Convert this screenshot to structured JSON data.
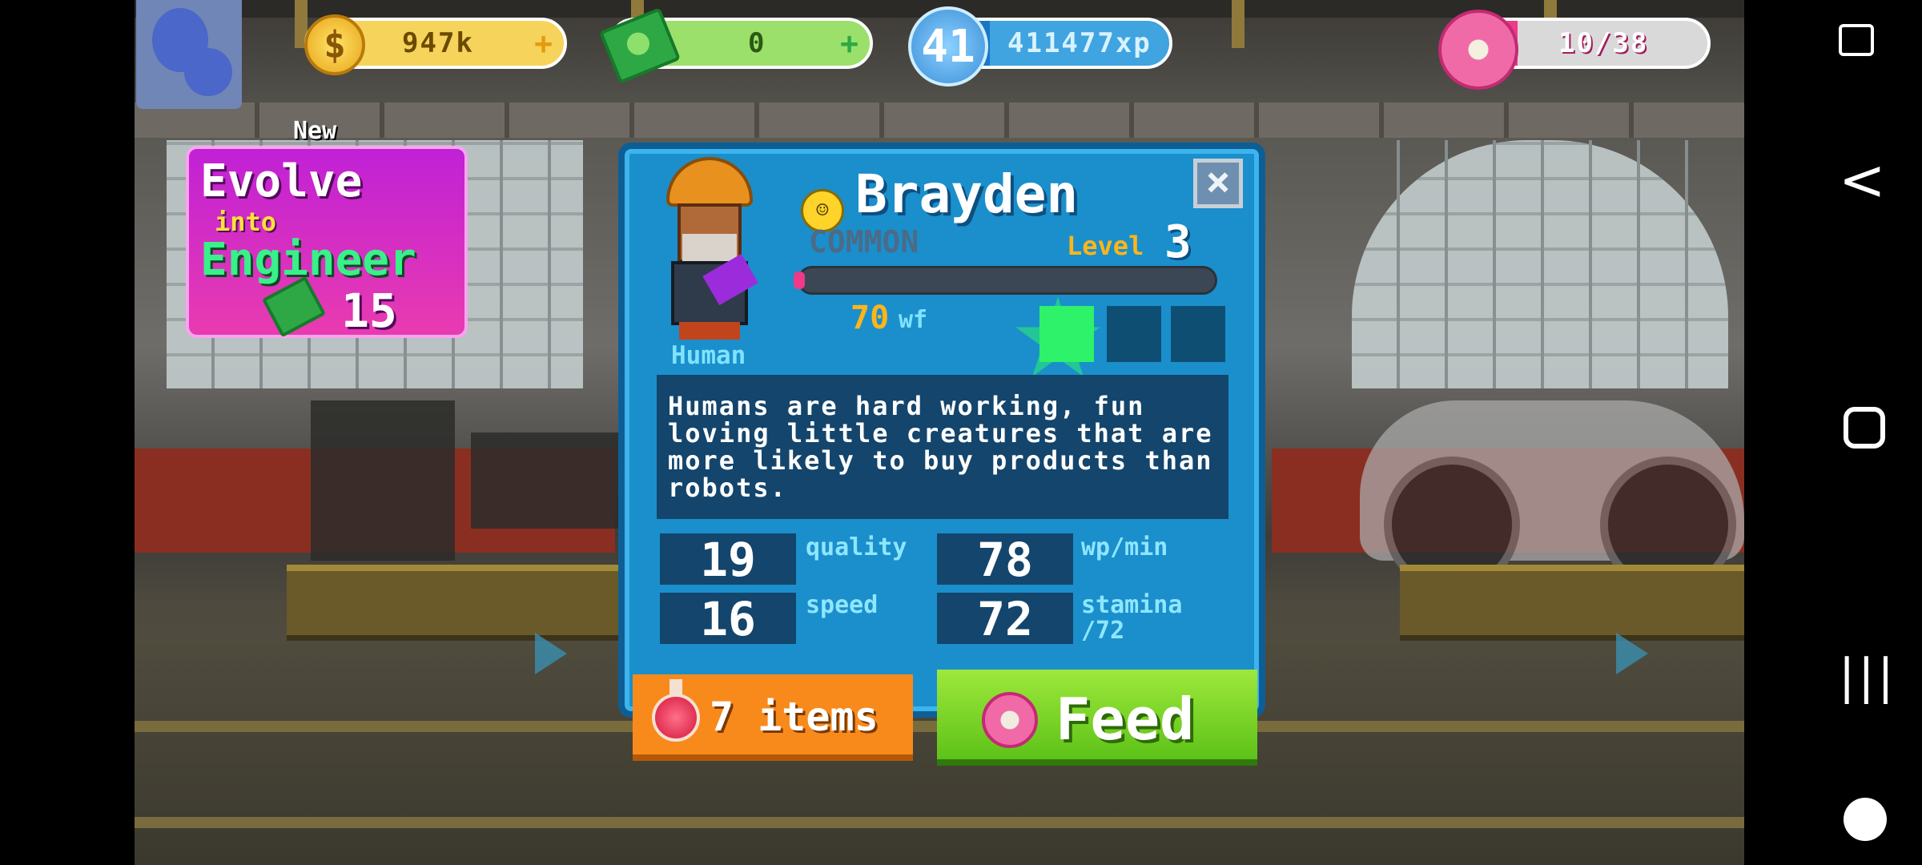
{
  "hud": {
    "coins": "947k",
    "coin_symbol": "$",
    "coin_plus": "+",
    "cash": "0",
    "cash_plus": "+",
    "player_level": "41",
    "xp": "411477xp",
    "xp_progress": 0.3,
    "donuts": "10/38",
    "donut_progress": 0.263
  },
  "evolve_card": {
    "new_tag": "New",
    "line1": "Evolve",
    "line2": "into",
    "line3": "Engineer",
    "cost": "15",
    "cost_icon": "cash-icon"
  },
  "worker": {
    "name": "Brayden",
    "race": "Human",
    "rarity": "COMMON",
    "level_label": "Level",
    "level": "3",
    "xp_progress": 0.0,
    "wf_value": "70",
    "wf_unit": "wf",
    "star_slots_filled": 1,
    "star_slots_total": 3,
    "description": "Humans are hard working, fun loving little creatures that are more likely to buy products than robots.",
    "mood_icon": "smiley-icon",
    "stats": [
      {
        "value": "19",
        "label": "quality"
      },
      {
        "value": "78",
        "label": "wp/min"
      },
      {
        "value": "16",
        "label": "speed"
      },
      {
        "value": "72",
        "label": "stamina",
        "sublabel": "/72"
      }
    ],
    "close_symbol": "×"
  },
  "actions": {
    "items_label": "7 items",
    "feed_label": "Feed"
  },
  "colors": {
    "dialog_bg": "#1a8fcc",
    "evolve_bg": "#c021d6",
    "feed_green": "#5dc218",
    "items_orange": "#f88a1c",
    "accent_yellow": "#ffb51a"
  },
  "system_nav": {
    "back_symbol": "<",
    "recent_symbol": "|||"
  }
}
